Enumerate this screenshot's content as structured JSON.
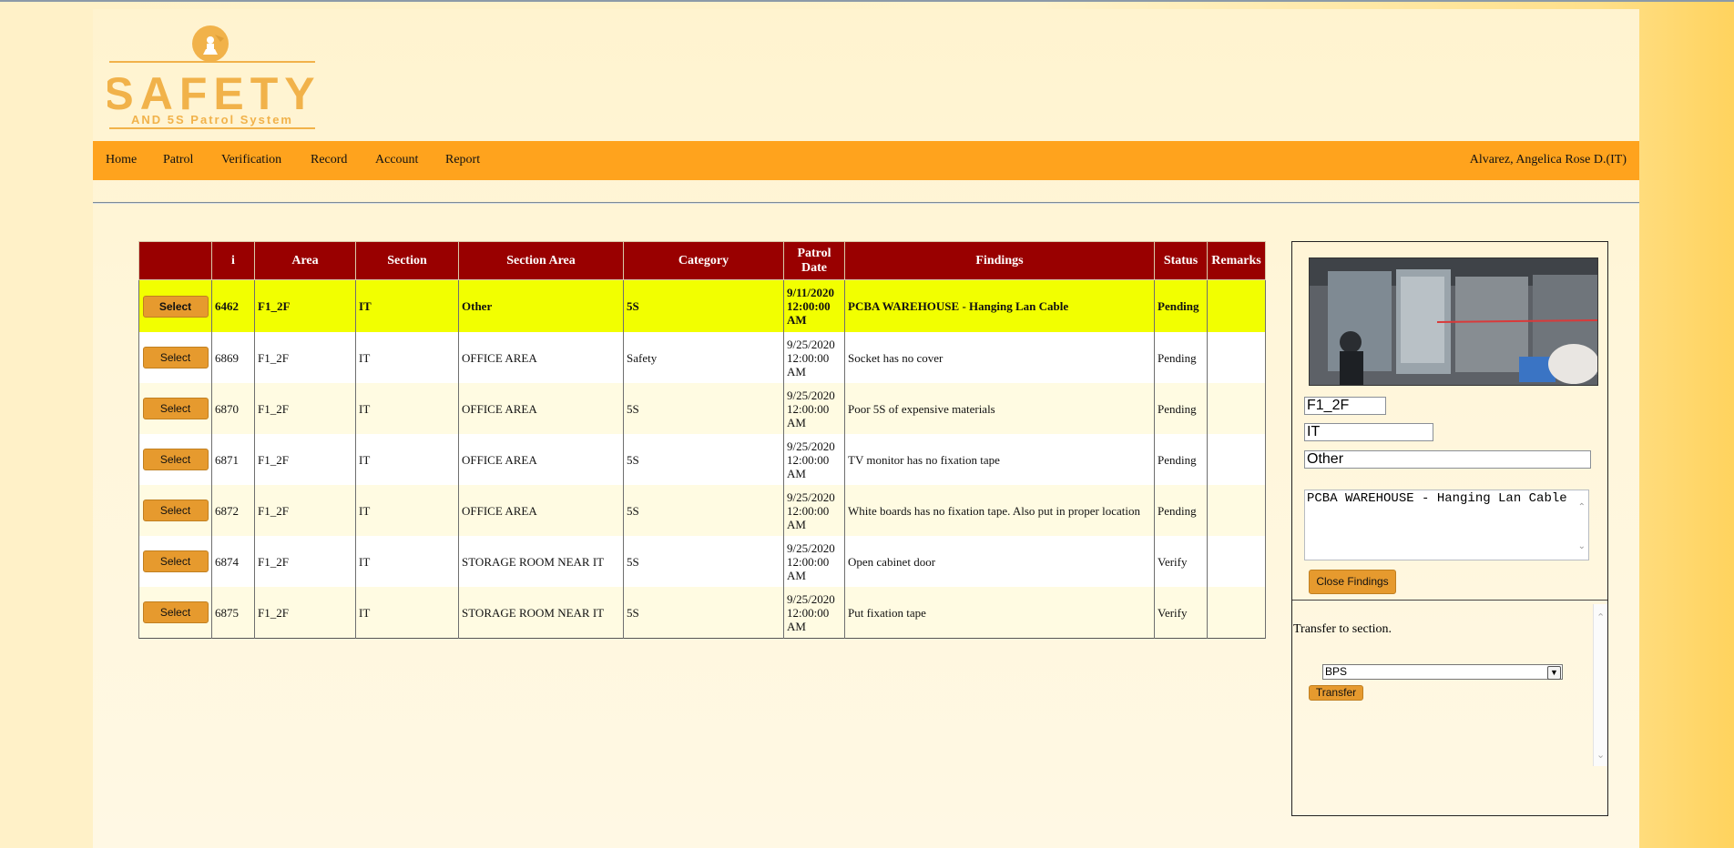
{
  "logo": {
    "word": "SAFETY",
    "tagline": "AND 5S Patrol System"
  },
  "nav": {
    "items": [
      "Home",
      "Patrol",
      "Verification",
      "Record",
      "Account",
      "Report"
    ],
    "user": "Alvarez, Angelica Rose D.(IT)"
  },
  "table": {
    "headers": [
      "",
      "i",
      "Area",
      "Section",
      "Section Area",
      "Category",
      "Patrol Date",
      "Findings",
      "Status",
      "Remarks"
    ],
    "select_label": "Select",
    "rows": [
      {
        "id": "6462",
        "area": "F1_2F",
        "section": "IT",
        "section_area": "Other",
        "category": "5S",
        "date": "9/11/2020 12:00:00 AM",
        "findings": "PCBA WAREHOUSE - Hanging Lan Cable",
        "status": "Pending",
        "remarks": ""
      },
      {
        "id": "6869",
        "area": "F1_2F",
        "section": "IT",
        "section_area": "OFFICE AREA",
        "category": "Safety",
        "date": "9/25/2020 12:00:00 AM",
        "findings": "Socket has no cover",
        "status": "Pending",
        "remarks": ""
      },
      {
        "id": "6870",
        "area": "F1_2F",
        "section": "IT",
        "section_area": "OFFICE AREA",
        "category": "5S",
        "date": "9/25/2020 12:00:00 AM",
        "findings": "Poor 5S of expensive materials",
        "status": "Pending",
        "remarks": ""
      },
      {
        "id": "6871",
        "area": "F1_2F",
        "section": "IT",
        "section_area": "OFFICE AREA",
        "category": "5S",
        "date": "9/25/2020 12:00:00 AM",
        "findings": "TV monitor has no fixation tape",
        "status": "Pending",
        "remarks": ""
      },
      {
        "id": "6872",
        "area": "F1_2F",
        "section": "IT",
        "section_area": "OFFICE AREA",
        "category": "5S",
        "date": "9/25/2020 12:00:00 AM",
        "findings": "White boards has no fixation tape. Also put in proper location",
        "status": "Pending",
        "remarks": ""
      },
      {
        "id": "6874",
        "area": "F1_2F",
        "section": "IT",
        "section_area": "STORAGE ROOM NEAR IT",
        "category": "5S",
        "date": "9/25/2020 12:00:00 AM",
        "findings": "Open cabinet door",
        "status": "Verify",
        "remarks": ""
      },
      {
        "id": "6875",
        "area": "F1_2F",
        "section": "IT",
        "section_area": "STORAGE ROOM NEAR IT",
        "category": "5S",
        "date": "9/25/2020 12:00:00 AM",
        "findings": "Put fixation tape",
        "status": "Verify",
        "remarks": ""
      }
    ]
  },
  "detail": {
    "area_value": "F1_2F",
    "section_value": "IT",
    "section_area_value": "Other",
    "findings_value": "PCBA WAREHOUSE - Hanging Lan Cable",
    "close_label": "Close Findings",
    "transfer_label": "Transfer to section.",
    "transfer_selected": "BPS",
    "transfer_button": "Transfer"
  },
  "colors": {
    "nav": "#ffa31d",
    "header": "#990000",
    "selected_row": "#f2ff00",
    "button": "#e69a2e"
  }
}
